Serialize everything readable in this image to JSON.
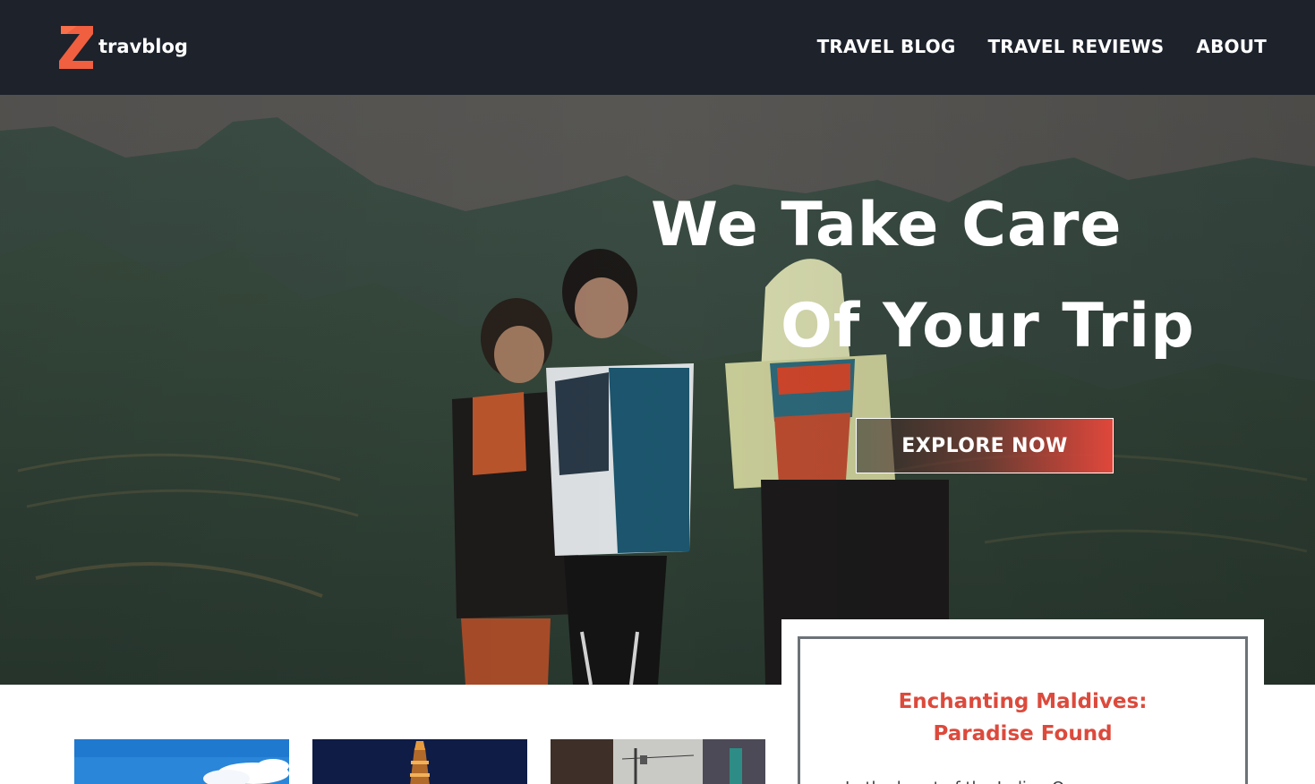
{
  "brand": {
    "logo_letter": "Z",
    "name": "travblog",
    "accent_color": "#f05f3f"
  },
  "nav": {
    "items": [
      {
        "label": "TRAVEL BLOG"
      },
      {
        "label": "TRAVEL REVIEWS"
      },
      {
        "label": "ABOUT"
      }
    ]
  },
  "hero": {
    "title_line1": "We Take Care",
    "title_line2": "Of Your Trip",
    "cta_label": "EXPLORE NOW",
    "cta_gradient_end": "#e0473b"
  },
  "featured_post": {
    "title_line1": "Enchanting Maldives:",
    "title_line2": "Paradise Found",
    "title_color": "#dc4a3c",
    "excerpt": "In the heart of the Indian Ocean..."
  },
  "thumbnails": [
    {
      "icon": "sky-clouds-image"
    },
    {
      "icon": "night-tower-image"
    },
    {
      "icon": "city-street-image"
    }
  ]
}
